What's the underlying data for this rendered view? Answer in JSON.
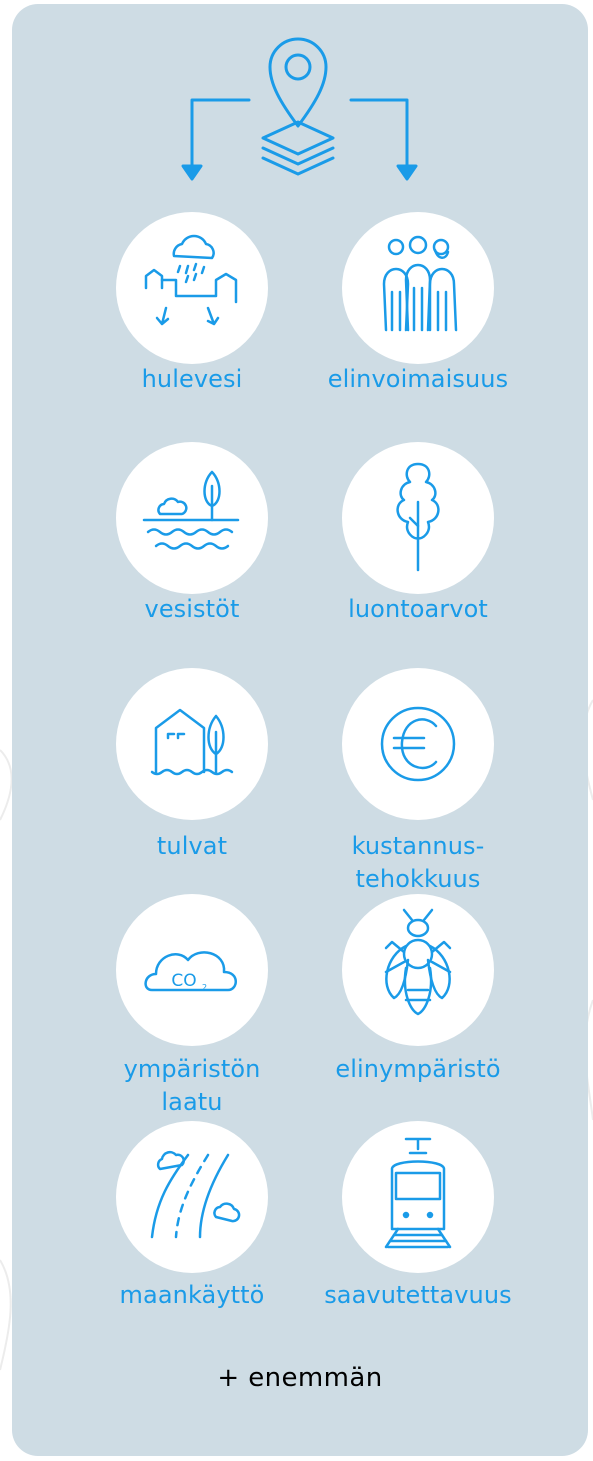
{
  "colors": {
    "accent": "#1a9be8",
    "panel": "#cedce4",
    "circle": "#ffffff",
    "more_text": "#000000"
  },
  "header": {
    "icon": "location-pin-layers-icon"
  },
  "items": [
    {
      "label": "hulevesi",
      "icon": "stormwater-icon"
    },
    {
      "label": "elinvoimaisuus",
      "icon": "people-icon"
    },
    {
      "label": "vesistöt",
      "icon": "waterbody-icon"
    },
    {
      "label": "luontoarvot",
      "icon": "tree-icon"
    },
    {
      "label": "tulvat",
      "icon": "flood-icon"
    },
    {
      "label": "kustannus-\ntehokkuus",
      "icon": "euro-icon"
    },
    {
      "label": "ympäristön\nlaatu",
      "icon": "co2-cloud-icon"
    },
    {
      "label": "elinympäristö",
      "icon": "insect-icon"
    },
    {
      "label": "maankäyttö",
      "icon": "road-landuse-icon"
    },
    {
      "label": "saavutettavuus",
      "icon": "tram-icon"
    }
  ],
  "more_label": "+ enemmän"
}
